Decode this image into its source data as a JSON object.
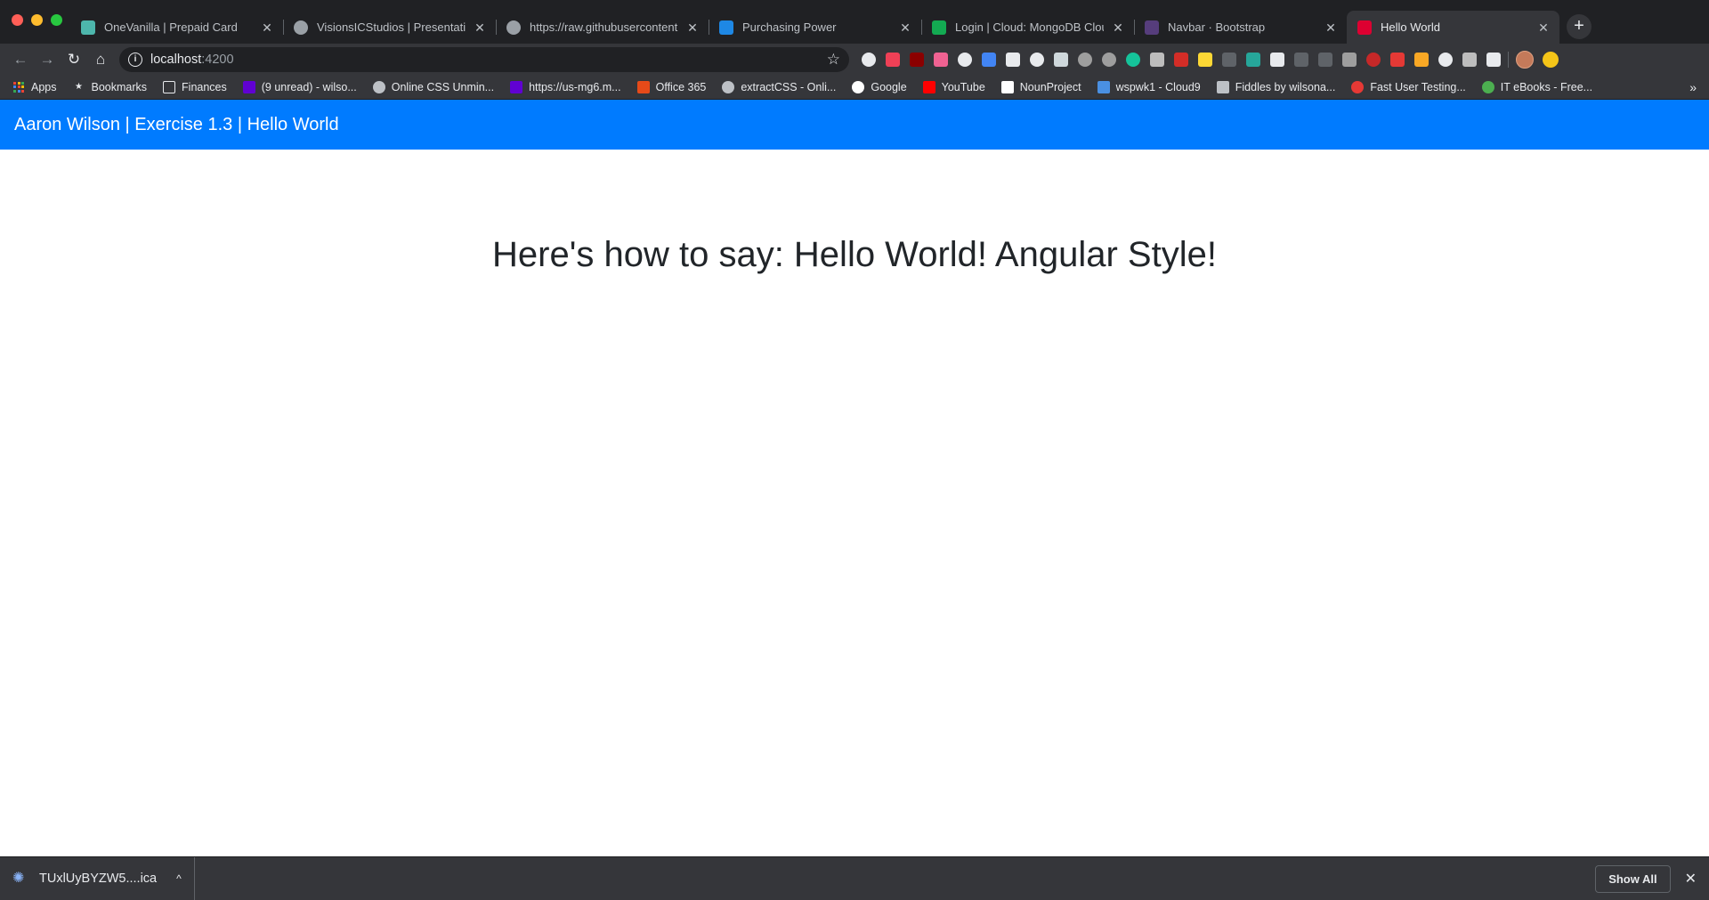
{
  "browser": {
    "tabs": [
      {
        "title": "OneVanilla | Prepaid Card",
        "icon": "onevanilla-favicon",
        "color": "#4db6ac"
      },
      {
        "title": "VisionsICStudios | Presentation",
        "icon": "globe-favicon",
        "color": "#9aa0a6"
      },
      {
        "title": "https://raw.githubusercontent.c",
        "icon": "globe-favicon",
        "color": "#9aa0a6"
      },
      {
        "title": "Purchasing Power",
        "icon": "purchasing-power-favicon",
        "color": "#1e88e5"
      },
      {
        "title": "Login | Cloud: MongoDB Cloud",
        "icon": "mongodb-leaf-favicon",
        "color": "#13aa52"
      },
      {
        "title": "Navbar · Bootstrap",
        "icon": "bootstrap-favicon",
        "color": "#563d7c"
      },
      {
        "title": "Hello World",
        "icon": "angular-favicon",
        "color": "#dd0031"
      }
    ],
    "active_tab_index": 6,
    "tab_close_glyph": "✕",
    "new_tab_glyph": "+",
    "address": {
      "host": "localhost",
      "port": ":4200"
    },
    "bookmarks": [
      {
        "label": "Apps",
        "icon": "apps-grid-icon",
        "color": "#e8eaed"
      },
      {
        "label": "Bookmarks",
        "icon": "star-icon",
        "color": "#e8eaed"
      },
      {
        "label": "Finances",
        "icon": "folder-icon",
        "color": "#e8eaed"
      },
      {
        "label": "(9 unread) - wilso...",
        "icon": "yahoo-icon",
        "color": "#6001d2"
      },
      {
        "label": "Online CSS Unmin...",
        "icon": "c-logo-icon",
        "color": "#bdc1c6"
      },
      {
        "label": "https://us-mg6.m...",
        "icon": "yahoo-icon",
        "color": "#6001d2"
      },
      {
        "label": "Office 365",
        "icon": "office-icon",
        "color": "#e64a19"
      },
      {
        "label": "extractCSS - Onli...",
        "icon": "globe-icon",
        "color": "#bdc1c6"
      },
      {
        "label": "Google",
        "icon": "google-icon",
        "color": "#ffffff"
      },
      {
        "label": "YouTube",
        "icon": "youtube-icon",
        "color": "#ff0000"
      },
      {
        "label": "NounProject",
        "icon": "nounproject-icon",
        "color": "#ffffff"
      },
      {
        "label": "wspwk1 - Cloud9",
        "icon": "cloud9-icon",
        "color": "#4a90e2"
      },
      {
        "label": "Fiddles by wilsona...",
        "icon": "jsfiddle-icon",
        "color": "#bdc1c6"
      },
      {
        "label": "Fast User Testing...",
        "icon": "fast-user-testing-icon",
        "color": "#e53935"
      },
      {
        "label": "IT eBooks - Free...",
        "icon": "it-ebooks-icon",
        "color": "#4caf50"
      }
    ],
    "bookmarks_more_glyph": "»",
    "extensions": [
      {
        "name": "gear-extension-icon",
        "color": "#e8eaed",
        "round": true
      },
      {
        "name": "pocket-extension-icon",
        "color": "#ef4056",
        "round": false
      },
      {
        "name": "red-extension-icon",
        "color": "#8b0000",
        "round": false
      },
      {
        "name": "pink-gradient-extension-icon",
        "color": "#f06292",
        "round": false
      },
      {
        "name": "eye-extension-icon",
        "color": "#e8eaed",
        "round": true
      },
      {
        "name": "color-picker-extension-icon",
        "color": "#4285f4",
        "round": false
      },
      {
        "name": "jb-extension-icon",
        "color": "#e8eaed",
        "round": false
      },
      {
        "name": "circle-extension-icon",
        "color": "#e8eaed",
        "round": true
      },
      {
        "name": "page-extension-icon",
        "color": "#cfd8dc",
        "round": false
      },
      {
        "name": "bulb-extension-icon",
        "color": "#9e9e9e",
        "round": true
      },
      {
        "name": "settings-extension-icon",
        "color": "#9e9e9e",
        "round": true
      },
      {
        "name": "grammarly-extension-icon",
        "color": "#15c39a",
        "round": true
      },
      {
        "name": "vue-extension-icon",
        "color": "#bdbdbd",
        "round": false
      },
      {
        "name": "lastpass-extension-icon",
        "color": "#d32d27",
        "round": false
      },
      {
        "name": "highlighter-extension-icon",
        "color": "#fdd835",
        "round": false
      },
      {
        "name": "css-extension-icon",
        "color": "#5f6368",
        "round": false
      },
      {
        "name": "wappalyzer-extension-icon",
        "color": "#26a69a",
        "round": false
      },
      {
        "name": "code-extension-icon",
        "color": "#e8eaed",
        "round": false
      },
      {
        "name": "css-viewer-extension-icon",
        "color": "#5f6368",
        "round": false
      },
      {
        "name": "java-extension-icon",
        "color": "#5f6368",
        "round": false
      },
      {
        "name": "stamp-extension-icon",
        "color": "#9e9e9e",
        "round": false
      },
      {
        "name": "red-badge-extension-icon",
        "color": "#c62828",
        "round": true
      },
      {
        "name": "flash-extension-icon",
        "color": "#e53935",
        "round": false
      },
      {
        "name": "hex-extension-icon",
        "color": "#f9a825",
        "round": false
      },
      {
        "name": "chrome-extension-icon",
        "color": "#e8eaed",
        "round": true
      },
      {
        "name": "t-extension-icon",
        "color": "#bdbdbd",
        "round": false
      },
      {
        "name": "notes-extension-icon",
        "color": "#e8eaed",
        "round": false
      }
    ]
  },
  "app": {
    "navbar_brand": "Aaron Wilson | Exercise 1.3 | Hello World",
    "heading": "Here's how to say: Hello World! Angular Style!",
    "accent_color": "#007bff"
  },
  "downloads": {
    "file_name": "TUxlUyBYZW5....ica",
    "chevron_glyph": "^",
    "show_all_label": "Show All",
    "close_glyph": "✕"
  }
}
